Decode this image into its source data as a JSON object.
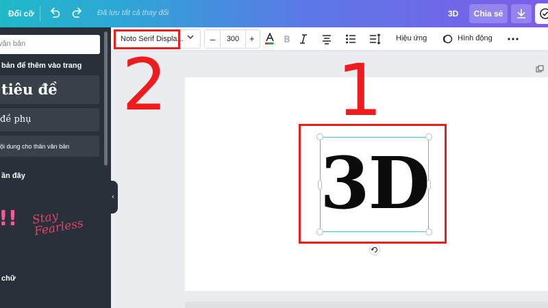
{
  "topbar": {
    "resize_label": "Đổi cỡ",
    "saved_status": "Đã lưu tất cả thay đổi",
    "dimension_label": "3D",
    "share_label": "Chia sẻ",
    "gradient_colors": [
      "#20b9c8",
      "#5b79e6",
      "#7d5ce9"
    ]
  },
  "sidebar": {
    "search_placeholder": "văn bản",
    "section_heading": "bản để thêm vào trang",
    "add_heading_label": "tiêu đề",
    "add_subheading_label": "đề phụ",
    "add_body_label": "ội dung cho thân văn bản",
    "recent_heading": "ần đây",
    "recent_item_1": "!!",
    "recent_item_2": "Stay Fearless",
    "fonts_heading": "chữ"
  },
  "toolbar": {
    "font_name": "Noto Serif Displa...",
    "font_size": "300",
    "decrease_label": "–",
    "increase_label": "+",
    "effects_label": "Hiệu ứng",
    "animate_label": "Hình động"
  },
  "canvas": {
    "text_content": "3D",
    "selection_color": "#37c6d0"
  },
  "annotations": {
    "label_1": "1",
    "label_2": "2",
    "color": "#ee1c1c"
  }
}
